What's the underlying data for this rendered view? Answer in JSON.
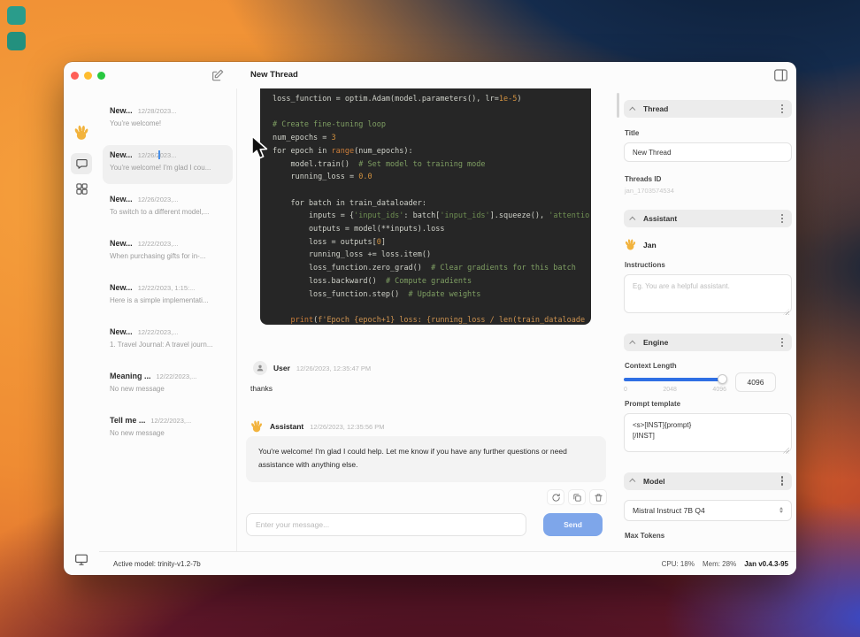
{
  "titlebar": {
    "title": "New Thread"
  },
  "sidebar": {
    "threads": [
      {
        "title": "New...",
        "date": "12/28/2023...",
        "preview": "You're welcome!",
        "selected": false
      },
      {
        "title": "New...",
        "date": "12/26/2023...",
        "preview": "You're welcome! I'm glad I cou...",
        "selected": true
      },
      {
        "title": "New...",
        "date": "12/26/2023,...",
        "preview": "To switch to a different model,...",
        "selected": false
      },
      {
        "title": "New...",
        "date": "12/22/2023,...",
        "preview": "When purchasing gifts for in-...",
        "selected": false
      },
      {
        "title": "New...",
        "date": "12/22/2023, 1:15:...",
        "preview": "Here is a simple implementati...",
        "selected": false
      },
      {
        "title": "New...",
        "date": "12/22/2023,...",
        "preview": "1. Travel Journal: A travel journ...",
        "selected": false
      },
      {
        "title": "Meaning ...",
        "date": "12/22/2023,...",
        "preview": "No new message",
        "selected": false
      },
      {
        "title": "Tell me ...",
        "date": "12/22/2023,...",
        "preview": "No new message",
        "selected": false
      }
    ]
  },
  "chat": {
    "code": {
      "lines": [
        [
          {
            "t": "loss_function = optim.Adam(model.parameters(), lr=",
            "c": "d"
          },
          {
            "t": "1e-5",
            "c": "n"
          },
          {
            "t": ")",
            "c": "d"
          }
        ],
        [],
        [
          {
            "t": "# Create fine-tuning loop",
            "c": "c"
          }
        ],
        [
          {
            "t": "num_epochs = ",
            "c": "d"
          },
          {
            "t": "3",
            "c": "n"
          }
        ],
        [
          {
            "t": "for epoch in ",
            "c": "d"
          },
          {
            "t": "range",
            "c": "k"
          },
          {
            "t": "(num_epochs):",
            "c": "d"
          }
        ],
        [
          {
            "t": "    model.train()  ",
            "c": "d"
          },
          {
            "t": "# Set model to training mode",
            "c": "c"
          }
        ],
        [
          {
            "t": "    running_loss = ",
            "c": "d"
          },
          {
            "t": "0.0",
            "c": "n"
          }
        ],
        [],
        [
          {
            "t": "    for batch in train_dataloader:",
            "c": "d"
          }
        ],
        [
          {
            "t": "        inputs = {",
            "c": "d"
          },
          {
            "t": "'input_ids'",
            "c": "s"
          },
          {
            "t": ": batch[",
            "c": "d"
          },
          {
            "t": "'input_ids'",
            "c": "s"
          },
          {
            "t": "].squeeze(), ",
            "c": "d"
          },
          {
            "t": "'attentio",
            "c": "s"
          }
        ],
        [
          {
            "t": "        outputs = model(**inputs).loss",
            "c": "d"
          }
        ],
        [
          {
            "t": "        loss = outputs[",
            "c": "d"
          },
          {
            "t": "0",
            "c": "n"
          },
          {
            "t": "]",
            "c": "d"
          }
        ],
        [
          {
            "t": "        running_loss += loss.item()",
            "c": "d"
          }
        ],
        [
          {
            "t": "        loss_function.zero_grad()  ",
            "c": "d"
          },
          {
            "t": "# Clear gradients for this batch",
            "c": "c"
          }
        ],
        [
          {
            "t": "        loss.backward()  ",
            "c": "d"
          },
          {
            "t": "# Compute gradients",
            "c": "c"
          }
        ],
        [
          {
            "t": "        loss_function.step()  ",
            "c": "d"
          },
          {
            "t": "# Update weights",
            "c": "c"
          }
        ],
        [],
        [
          {
            "t": "    ",
            "c": "d"
          },
          {
            "t": "print",
            "c": "k"
          },
          {
            "t": "(",
            "c": "d"
          },
          {
            "t": "f'Epoch {epoch+1} loss: {running_loss / len(train_dataloade",
            "c": "f"
          }
        ]
      ]
    },
    "messages": [
      {
        "author": "User",
        "timestamp": "12/26/2023, 12:35:47 PM",
        "text": "thanks"
      },
      {
        "author": "Assistant",
        "timestamp": "12/26/2023, 12:35:56 PM",
        "text": "You're welcome! I'm glad I could help. Let me know if you have any further questions or need assistance with anything else."
      }
    ],
    "input_placeholder": "Enter your message...",
    "send_label": "Send"
  },
  "right_panel": {
    "thread": {
      "header": "Thread",
      "title_label": "Title",
      "title_value": "New Thread",
      "id_label": "Threads ID",
      "id_value": "jan_1703574534"
    },
    "assistant": {
      "header": "Assistant",
      "name": "Jan",
      "instructions_label": "Instructions",
      "instructions_placeholder": "Eg. You are a helpful assistant."
    },
    "engine": {
      "header": "Engine",
      "context_label": "Context Length",
      "context_value": "4096",
      "ticks": [
        "0",
        "2048",
        "4096"
      ],
      "prompt_label": "Prompt template",
      "prompt_value": "<s>[INST]{prompt}\n[/INST]"
    },
    "model": {
      "header": "Model",
      "selected": "Mistral Instruct 7B Q4",
      "max_tokens_label": "Max Tokens"
    }
  },
  "statusbar": {
    "active_model": "Active model: trinity-v1.2-7b",
    "cpu": "CPU: 18%",
    "mem": "Mem: 28%",
    "version": "Jan v0.4.3-95"
  },
  "colors": {
    "accent_blue": "#2f6fe4",
    "send_blue": "#7ea6ea",
    "code_bg": "#262626"
  }
}
